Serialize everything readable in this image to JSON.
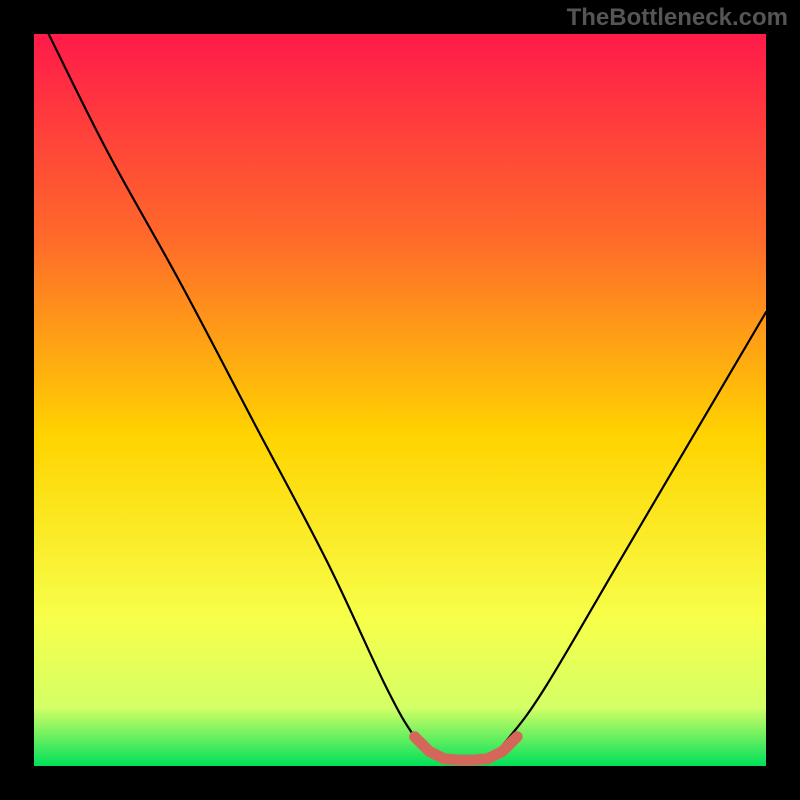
{
  "watermark": "TheBottleneck.com",
  "colors": {
    "gradient_top": "#ff1a4a",
    "gradient_mid_upper": "#ff6a2a",
    "gradient_mid": "#ffd400",
    "gradient_mid_lower": "#f7ff4a",
    "gradient_lower": "#d4ff66",
    "gradient_bottom": "#00e05a",
    "curve": "#000000",
    "marker": "#d4675a",
    "frame": "#000000"
  },
  "chart_data": {
    "type": "line",
    "title": "",
    "xlabel": "",
    "ylabel": "",
    "xlim": [
      0,
      100
    ],
    "ylim": [
      0,
      100
    ],
    "grid": false,
    "series": [
      {
        "name": "bottleneck-curve",
        "x": [
          2,
          10,
          20,
          30,
          40,
          48,
          52,
          55,
          58,
          60,
          62,
          65,
          70,
          80,
          90,
          100
        ],
        "y": [
          100,
          84,
          66,
          47,
          28,
          11,
          4,
          1,
          0.5,
          0.5,
          1,
          4,
          11,
          28,
          45,
          62
        ]
      }
    ],
    "markers": {
      "name": "optimal-range",
      "x": [
        52,
        54,
        56,
        58,
        60,
        62,
        64,
        66
      ],
      "y": [
        4,
        2,
        1,
        0.8,
        0.8,
        1,
        2,
        4
      ]
    }
  }
}
